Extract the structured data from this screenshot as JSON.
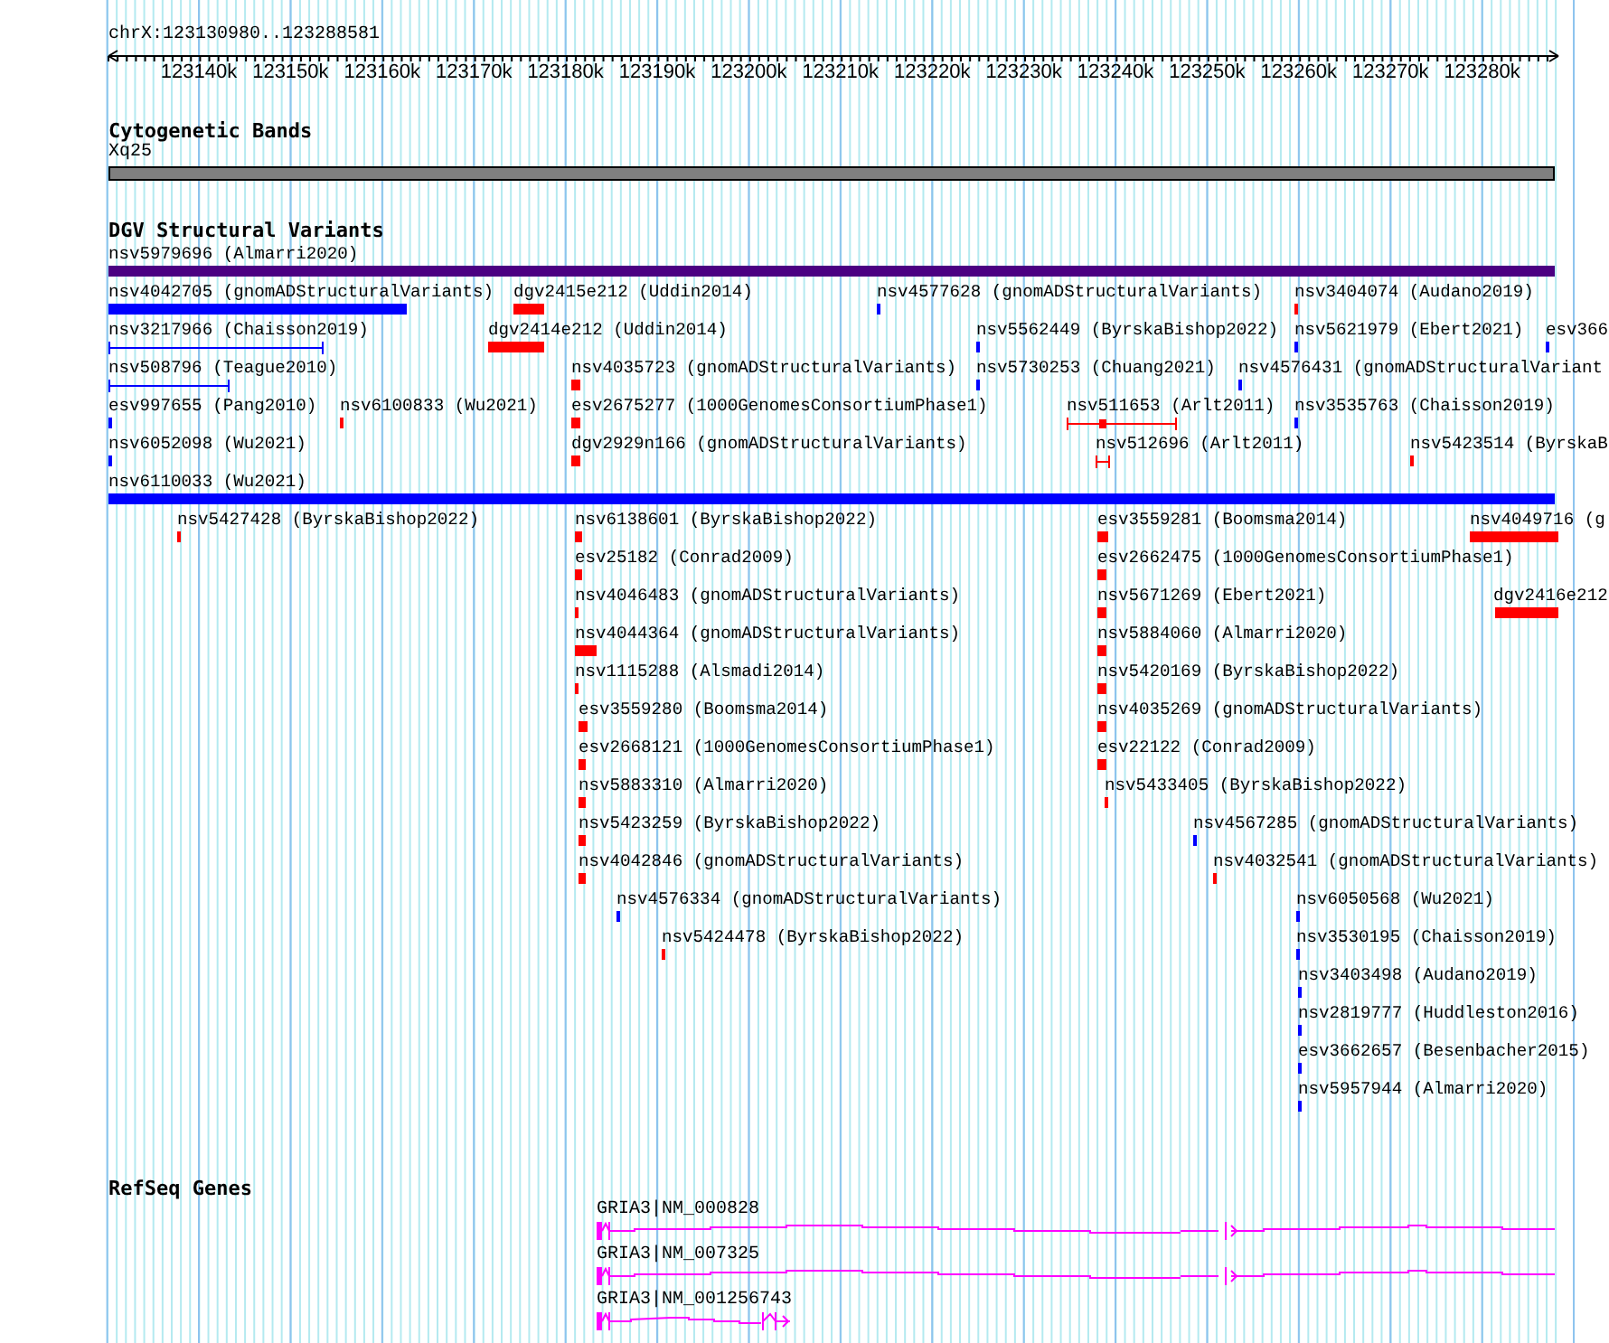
{
  "ruler": {
    "position": "chrX:123130980..123288581",
    "ticks": [
      "123140k",
      "123150k",
      "123160k",
      "123170k",
      "123180k",
      "123190k",
      "123200k",
      "123210k",
      "123220k",
      "123230k",
      "123240k",
      "123250k",
      "123260k",
      "123270k",
      "123280k"
    ]
  },
  "cytobands": {
    "title": "Cytogenetic Bands",
    "bands": [
      {
        "name": "Xq25"
      }
    ]
  },
  "variants": {
    "title": "DGV Structural Variants",
    "features": [
      {
        "label": "nsv5979696 (Almarri2020)",
        "color": "#4b0082",
        "kind": "bar"
      },
      {
        "label": "nsv4042705 (gnomADStructuralVariants)",
        "color": "#0000ff",
        "kind": "bar"
      },
      {
        "label": "dgv2415e212 (Uddin2014)",
        "color": "#ff0000",
        "kind": "bar"
      },
      {
        "label": "nsv4577628 (gnomADStructuralVariants)",
        "color": "#0000ff",
        "kind": "bar"
      },
      {
        "label": "nsv3404074 (Audano2019)",
        "color": "#ff0000",
        "kind": "bar"
      },
      {
        "label": "nsv3217966 (Chaisson2019)",
        "color": "#0000ff",
        "kind": "span"
      },
      {
        "label": "dgv2414e212 (Uddin2014)",
        "color": "#ff0000",
        "kind": "bar"
      },
      {
        "label": "nsv5562449 (ByrskaBishop2022)",
        "color": "#0000ff",
        "kind": "bar"
      },
      {
        "label": "nsv5621979 (Ebert2021)",
        "color": "#0000ff",
        "kind": "bar"
      },
      {
        "label": "esv366",
        "color": "#0000ff",
        "kind": "bar"
      },
      {
        "label": "nsv508796 (Teague2010)",
        "color": "#0000ff",
        "kind": "span"
      },
      {
        "label": "nsv4035723 (gnomADStructuralVariants)",
        "color": "#ff0000",
        "kind": "bar"
      },
      {
        "label": "nsv5730253 (Chuang2021)",
        "color": "#0000ff",
        "kind": "bar"
      },
      {
        "label": "nsv4576431 (gnomADStructuralVariant",
        "color": "#0000ff",
        "kind": "bar"
      },
      {
        "label": "esv997655 (Pang2010)",
        "color": "#0000ff",
        "kind": "bar"
      },
      {
        "label": "nsv6100833 (Wu2021)",
        "color": "#ff0000",
        "kind": "bar"
      },
      {
        "label": "esv2675277 (1000GenomesConsortiumPhase1)",
        "color": "#ff0000",
        "kind": "bar"
      },
      {
        "label": "nsv511653 (Arlt2011)",
        "color": "#ff0000",
        "kind": "span"
      },
      {
        "label": "nsv3535763 (Chaisson2019)",
        "color": "#0000ff",
        "kind": "bar"
      },
      {
        "label": "nsv6052098 (Wu2021)",
        "color": "#0000ff",
        "kind": "bar"
      },
      {
        "label": "dgv2929n166 (gnomADStructuralVariants)",
        "color": "#ff0000",
        "kind": "bar"
      },
      {
        "label": "nsv512696 (Arlt2011)",
        "color": "#ff0000",
        "kind": "span"
      },
      {
        "label": "nsv5423514 (ByrskaB",
        "color": "#ff0000",
        "kind": "bar"
      },
      {
        "label": "nsv6110033 (Wu2021)",
        "color": "#0000ff",
        "kind": "bar"
      },
      {
        "label": "nsv5427428 (ByrskaBishop2022)",
        "color": "#ff0000",
        "kind": "bar"
      },
      {
        "label": "nsv6138601 (ByrskaBishop2022)",
        "color": "#ff0000",
        "kind": "bar"
      },
      {
        "label": "esv3559281 (Boomsma2014)",
        "color": "#ff0000",
        "kind": "bar"
      },
      {
        "label": "nsv4049716 (g",
        "color": "#ff0000",
        "kind": "bar"
      },
      {
        "label": "esv25182 (Conrad2009)",
        "color": "#ff0000",
        "kind": "bar"
      },
      {
        "label": "esv2662475 (1000GenomesConsortiumPhase1)",
        "color": "#ff0000",
        "kind": "bar"
      },
      {
        "label": "nsv4046483 (gnomADStructuralVariants)",
        "color": "#ff0000",
        "kind": "bar"
      },
      {
        "label": "nsv5671269 (Ebert2021)",
        "color": "#ff0000",
        "kind": "bar"
      },
      {
        "label": "dgv2416e212",
        "color": "#ff0000",
        "kind": "bar"
      },
      {
        "label": "nsv4044364 (gnomADStructuralVariants)",
        "color": "#ff0000",
        "kind": "bar"
      },
      {
        "label": "nsv5884060 (Almarri2020)",
        "color": "#ff0000",
        "kind": "bar"
      },
      {
        "label": "nsv1115288 (Alsmadi2014)",
        "color": "#ff0000",
        "kind": "bar"
      },
      {
        "label": "nsv5420169 (ByrskaBishop2022)",
        "color": "#ff0000",
        "kind": "bar"
      },
      {
        "label": "esv3559280 (Boomsma2014)",
        "color": "#ff0000",
        "kind": "bar"
      },
      {
        "label": "nsv4035269 (gnomADStructuralVariants)",
        "color": "#ff0000",
        "kind": "bar"
      },
      {
        "label": "esv2668121 (1000GenomesConsortiumPhase1)",
        "color": "#ff0000",
        "kind": "bar"
      },
      {
        "label": "esv22122 (Conrad2009)",
        "color": "#ff0000",
        "kind": "bar"
      },
      {
        "label": "nsv5883310 (Almarri2020)",
        "color": "#ff0000",
        "kind": "bar"
      },
      {
        "label": "nsv5433405 (ByrskaBishop2022)",
        "color": "#ff0000",
        "kind": "bar"
      },
      {
        "label": "nsv5423259 (ByrskaBishop2022)",
        "color": "#ff0000",
        "kind": "bar"
      },
      {
        "label": "nsv4567285 (gnomADStructuralVariants)",
        "color": "#0000ff",
        "kind": "bar"
      },
      {
        "label": "nsv4042846 (gnomADStructuralVariants)",
        "color": "#ff0000",
        "kind": "bar"
      },
      {
        "label": "nsv4032541 (gnomADStructuralVariants)",
        "color": "#ff0000",
        "kind": "bar"
      },
      {
        "label": "nsv4576334 (gnomADStructuralVariants)",
        "color": "#0000ff",
        "kind": "bar"
      },
      {
        "label": "nsv6050568 (Wu2021)",
        "color": "#0000ff",
        "kind": "bar"
      },
      {
        "label": "nsv5424478 (ByrskaBishop2022)",
        "color": "#ff0000",
        "kind": "bar"
      },
      {
        "label": "nsv3530195 (Chaisson2019)",
        "color": "#0000ff",
        "kind": "bar"
      },
      {
        "label": "nsv3403498 (Audano2019)",
        "color": "#0000ff",
        "kind": "bar"
      },
      {
        "label": "nsv2819777 (Huddleston2016)",
        "color": "#0000ff",
        "kind": "bar"
      },
      {
        "label": "esv3662657 (Besenbacher2015)",
        "color": "#0000ff",
        "kind": "bar"
      },
      {
        "label": "nsv5957944 (Almarri2020)",
        "color": "#0000ff",
        "kind": "bar"
      }
    ]
  },
  "genes": {
    "title": "RefSeq Genes",
    "transcripts": [
      {
        "label": "GRIA3|NM_000828"
      },
      {
        "label": "GRIA3|NM_007325"
      },
      {
        "label": "GRIA3|NM_001256743"
      }
    ]
  }
}
